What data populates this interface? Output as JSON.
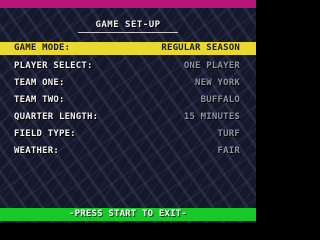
{
  "screen": {
    "title": "GAME SET-UP",
    "exit_prompt": "-PRESS START TO EXIT-"
  },
  "settings": [
    {
      "label": "GAME MODE:",
      "value": "REGULAR SEASON",
      "highlighted": true
    },
    {
      "label": "PLAYER SELECT:",
      "value": "ONE PLAYER"
    },
    {
      "label": "TEAM ONE:",
      "value": "NEW YORK"
    },
    {
      "label": "TEAM TWO:",
      "value": "BUFFALO"
    },
    {
      "label": "QUARTER LENGTH:",
      "value": "15 MINUTES"
    },
    {
      "label": "FIELD TYPE:",
      "value": "TURF"
    },
    {
      "label": "WEATHER:",
      "value": "FAIR"
    }
  ],
  "colors": {
    "top_bar": "#b8147a",
    "highlight_bar": "#e8d830",
    "bottom_bar": "#16c828",
    "label_text": "#f2f2f2",
    "value_text": "#8e92a4"
  }
}
